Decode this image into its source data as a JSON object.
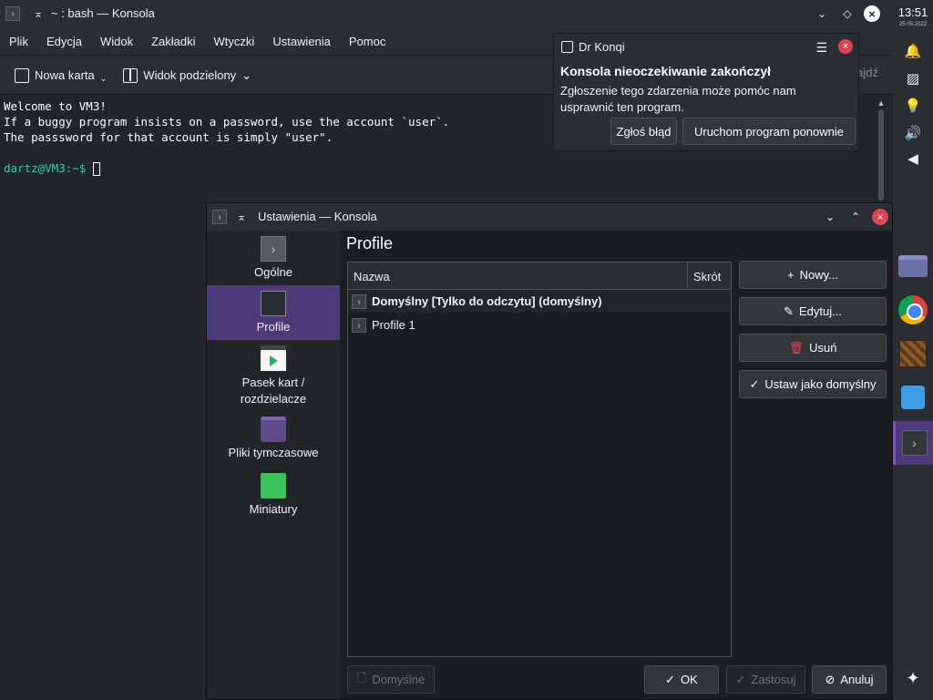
{
  "konsole": {
    "title": "~ : bash — Konsola",
    "menu": [
      "Plik",
      "Edycja",
      "Widok",
      "Zakładki",
      "Wtyczki",
      "Ustawienia",
      "Pomoc"
    ],
    "toolbar": {
      "new_tab": "Nowa karta",
      "split_view": "Widok podzielony",
      "find": "Znajdź"
    },
    "terminal": {
      "lines": [
        "Welcome to VM3!",
        "If a buggy program insists on a password, use the account `user`.",
        "The passsword for that account is simply \"user\"."
      ],
      "prompt_user": "dartz@VM3",
      "prompt_path": ":~$"
    }
  },
  "panel": {
    "time": "13:51",
    "date": "25.05.2022"
  },
  "notification": {
    "app": "Dr Konqi",
    "title": "Konsola nieoczekiwanie zakończył",
    "body": "Zgłoszenie tego zdarzenia może pomóc nam usprawnić ten program.",
    "report_button": "Zgłoś błąd",
    "restart_button": "Uruchom program ponownie"
  },
  "dialog": {
    "title": "Ustawienia — Konsola",
    "heading": "Profile",
    "sidebar": [
      {
        "label": "Ogólne",
        "icon": "terminal-icon"
      },
      {
        "label": "Profile",
        "icon": "profile-icon",
        "active": true
      },
      {
        "label": "Pasek kart / rozdzielacze",
        "icon": "tabbar-icon"
      },
      {
        "label": "Pliki tymczasowe",
        "icon": "temp-folder-icon"
      },
      {
        "label": "Miniatury",
        "icon": "thumbnails-icon"
      }
    ],
    "table": {
      "col_name": "Nazwa",
      "col_shortcut": "Skrót",
      "rows": [
        "Domyślny [Tylko do odczytu] (domyślny)",
        "Profile 1"
      ]
    },
    "buttons": {
      "new": "Nowy...",
      "edit": "Edytuj...",
      "delete": "Usuń",
      "set_default": "Ustaw jako domyślny",
      "defaults": "Domyślne",
      "ok": "OK",
      "apply": "Zastosuj",
      "cancel": "Anuluj"
    }
  }
}
